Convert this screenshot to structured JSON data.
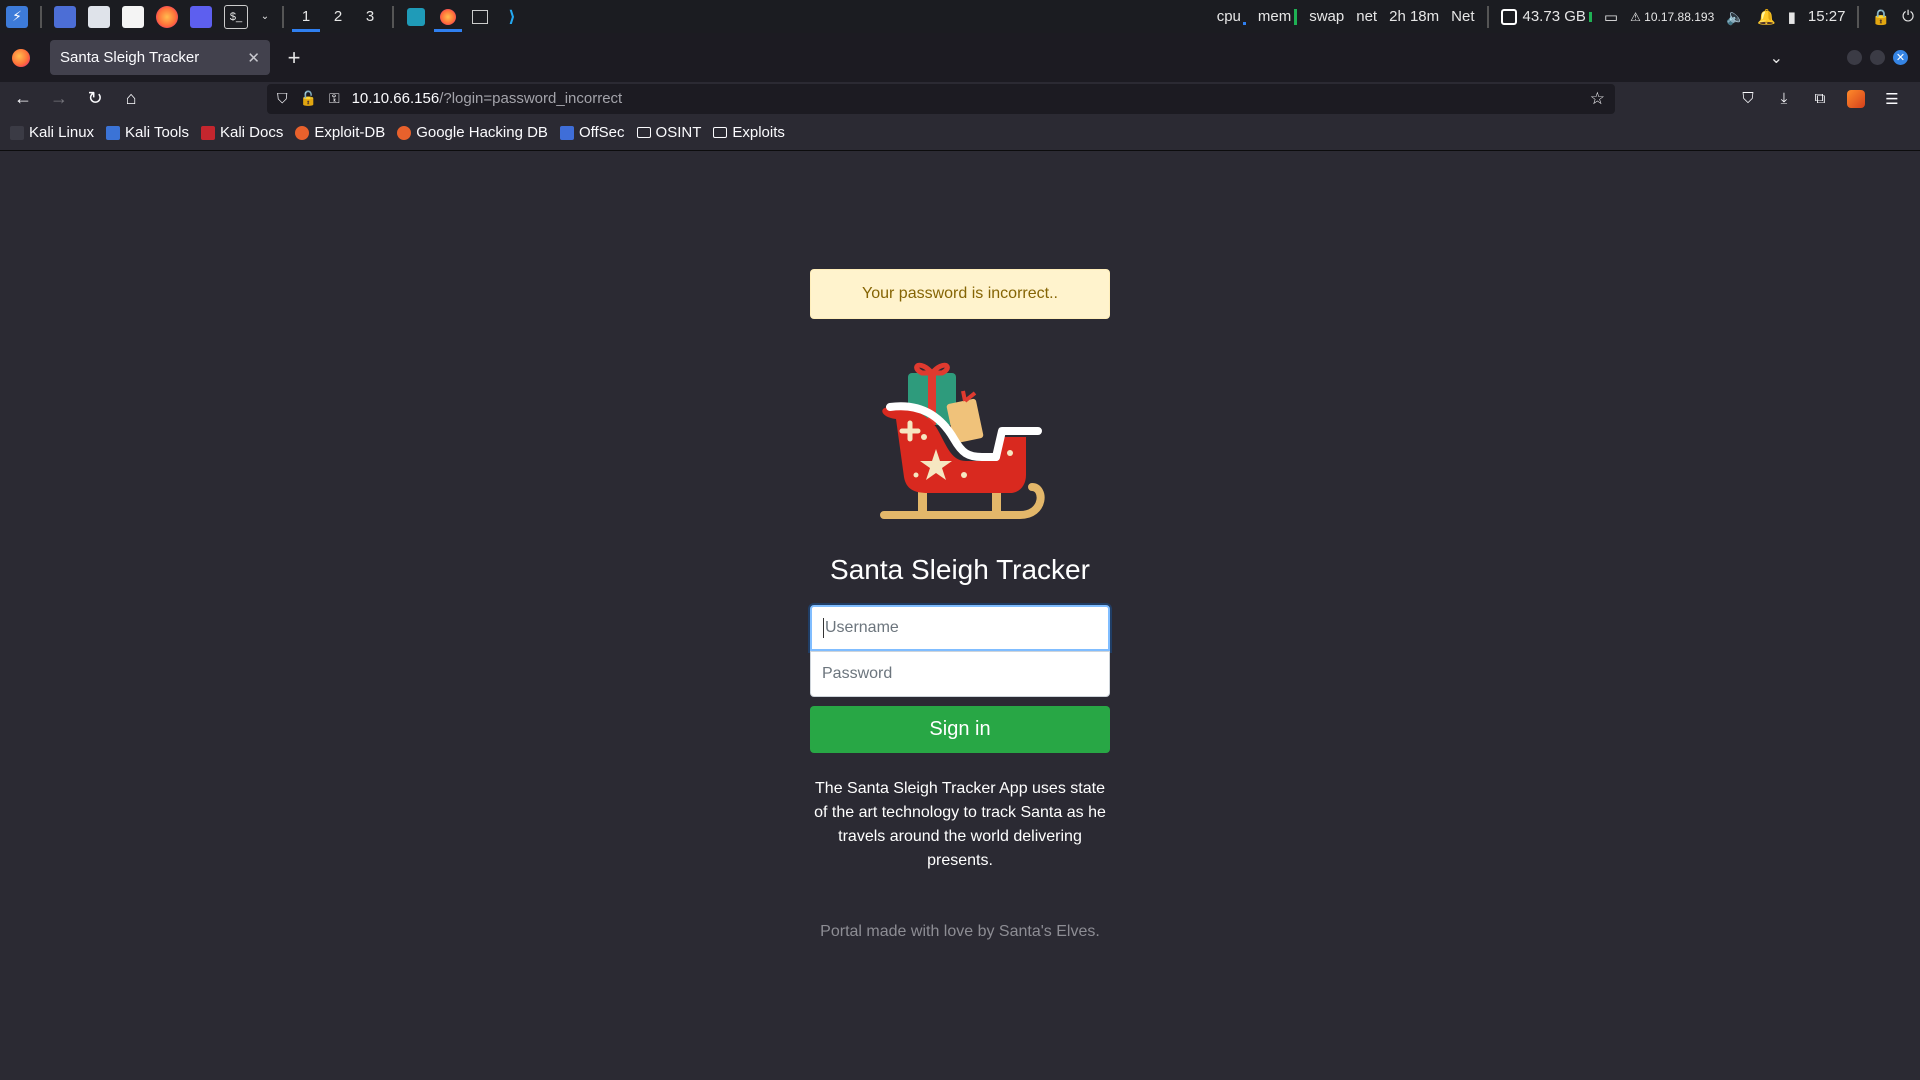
{
  "taskbar": {
    "workspaces": [
      "1",
      "2",
      "3"
    ],
    "active_workspace": "1",
    "cpu_label": "cpu",
    "mem_label": "mem",
    "swap_label": "swap",
    "net_label": "net",
    "uptime": "2h 18m",
    "net2_label": "Net",
    "disk": "43.73 GB",
    "ip": "10.17.88.193",
    "clock": "15:27"
  },
  "browser": {
    "tab_title": "Santa Sleigh Tracker",
    "url_host": "10.10.66.156",
    "url_path": "/?login=password_incorrect"
  },
  "bookmarks": [
    {
      "label": "Kali Linux",
      "icon": "kali-dragon-icon"
    },
    {
      "label": "Kali Tools",
      "icon": "kali-tools-icon"
    },
    {
      "label": "Kali Docs",
      "icon": "kali-docs-icon"
    },
    {
      "label": "Exploit-DB",
      "icon": "exploit-db-icon"
    },
    {
      "label": "Google Hacking DB",
      "icon": "ghdb-icon"
    },
    {
      "label": "OffSec",
      "icon": "offsec-icon"
    },
    {
      "label": "OSINT",
      "icon": "folder-icon"
    },
    {
      "label": "Exploits",
      "icon": "folder-icon"
    }
  ],
  "page": {
    "alert": "Your password is incorrect..",
    "title": "Santa Sleigh Tracker",
    "username_placeholder": "Username",
    "password_placeholder": "Password",
    "signin_label": "Sign in",
    "description": "The Santa Sleigh Tracker App uses state of the art technology to track Santa as he travels around the world delivering presents.",
    "footer": "Portal made with love by Santa's Elves."
  },
  "colors": {
    "page_bg": "#2b2a33",
    "signin_green": "#28a745",
    "alert_bg": "#fff3cd",
    "alert_text": "#856404"
  }
}
